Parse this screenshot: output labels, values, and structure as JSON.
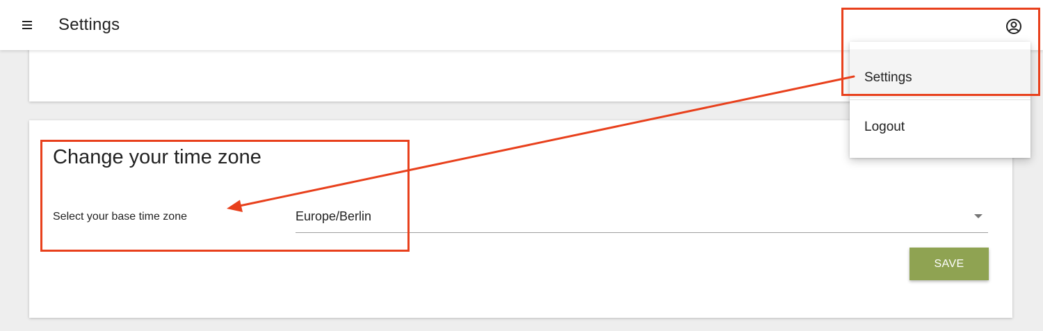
{
  "header": {
    "title": "Settings",
    "menu_icon": "hamburger-menu-icon",
    "account_icon": "account-circle-icon"
  },
  "account_menu": {
    "items": [
      {
        "label": "Settings"
      },
      {
        "label": "Logout"
      }
    ]
  },
  "timezone_card": {
    "title": "Change your time zone",
    "label": "Select your base time zone",
    "selected_value": "Europe/Berlin",
    "save_label": "SAVE"
  },
  "colors": {
    "accent": "#8fa352",
    "annotation": "#e8401c",
    "background": "#eeeeee"
  }
}
